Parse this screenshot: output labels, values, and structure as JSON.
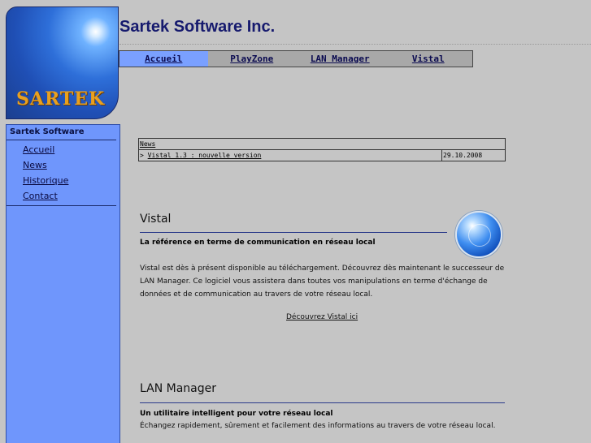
{
  "logo": {
    "text": "Sartek"
  },
  "header": {
    "title": "Sartek Software Inc."
  },
  "nav": {
    "items": [
      {
        "label": "Accueil",
        "active": true
      },
      {
        "label": "PlayZone"
      },
      {
        "label": "LAN Manager"
      },
      {
        "label": "Vistal"
      }
    ]
  },
  "sidebar": {
    "title": "Sartek Software",
    "items": [
      {
        "label": "Accueil"
      },
      {
        "label": "News"
      },
      {
        "label": "Historique"
      },
      {
        "label": "Contact"
      }
    ]
  },
  "news": {
    "header": "News",
    "rows": [
      {
        "prefix": ">",
        "title": "Vistal 1.3 : nouvelle version",
        "date": "29.10.2008"
      }
    ]
  },
  "vistal": {
    "title": "Vistal",
    "subtitle": "La référence en terme de communication en réseau local",
    "body": "Vistal est dès à présent disponible au téléchargement. Découvrez dès maintenant le successeur de LAN Manager. Ce logiciel vous assistera dans toutes vos manipulations en terme d'échange de données et de communication au travers de votre réseau local.",
    "link": "Découvrez Vistal ici"
  },
  "lanmanager": {
    "title": "LAN Manager",
    "subtitle": "Un utilitaire intelligent pour votre réseau local",
    "body": "Échangez rapidement, sûrement et facilement des informations au travers de votre réseau local."
  },
  "colors": {
    "sidebar": "#6f96fc",
    "title": "#161a6e",
    "nav_active": "#7aa0ff"
  }
}
